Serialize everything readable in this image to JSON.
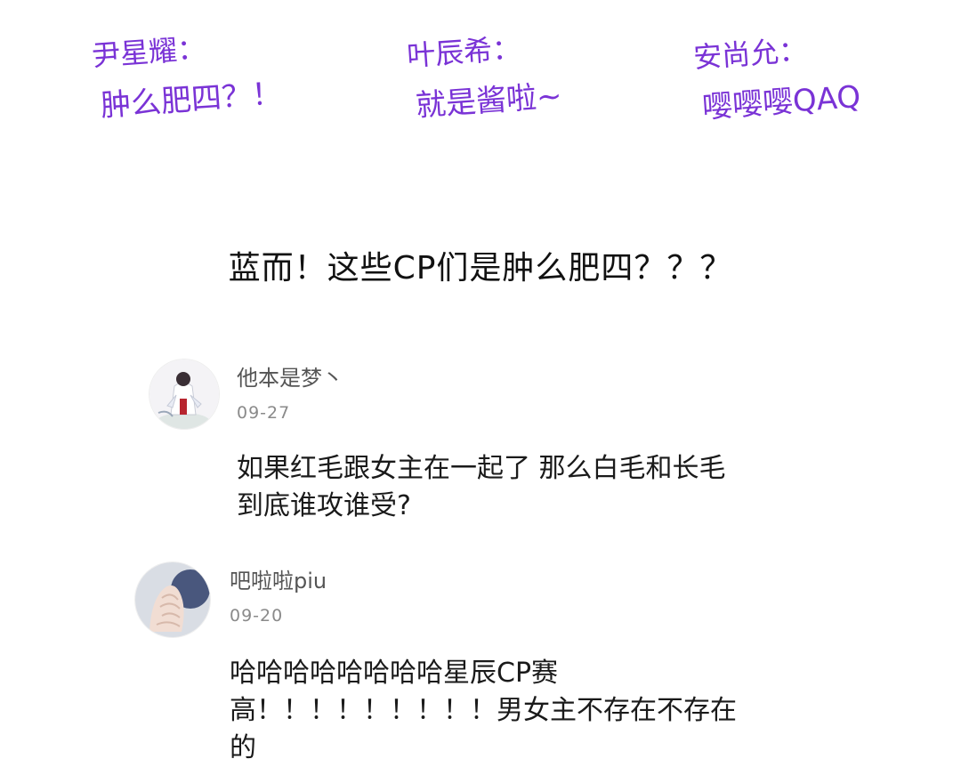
{
  "characters": [
    {
      "name": "尹星耀：",
      "line": "肿么肥四？！"
    },
    {
      "name": "叶辰希：",
      "line": "就是酱啦~"
    },
    {
      "name": "安尚允：",
      "line": "嘤嘤嘤QAQ"
    }
  ],
  "caption": "蓝而！这些CP们是肿么肥四？？？",
  "comments": [
    {
      "username": "他本是梦丶",
      "date": "09-27",
      "body": [
        "如果红毛跟女主在一起了 那么白毛和长毛",
        "到底谁攻谁受?"
      ]
    },
    {
      "username": "吧啦啦piu",
      "date": "09-20",
      "body": [
        "哈哈哈哈哈哈哈哈星辰CP赛",
        "高！！！！！！！！！男女主不存在不存在",
        "的"
      ]
    }
  ],
  "colors": {
    "character_text": "#7a33d6",
    "caption_text": "#111111",
    "username": "#555555",
    "timestamp": "#8a8a8a",
    "comment_body": "#1a1a1a"
  }
}
